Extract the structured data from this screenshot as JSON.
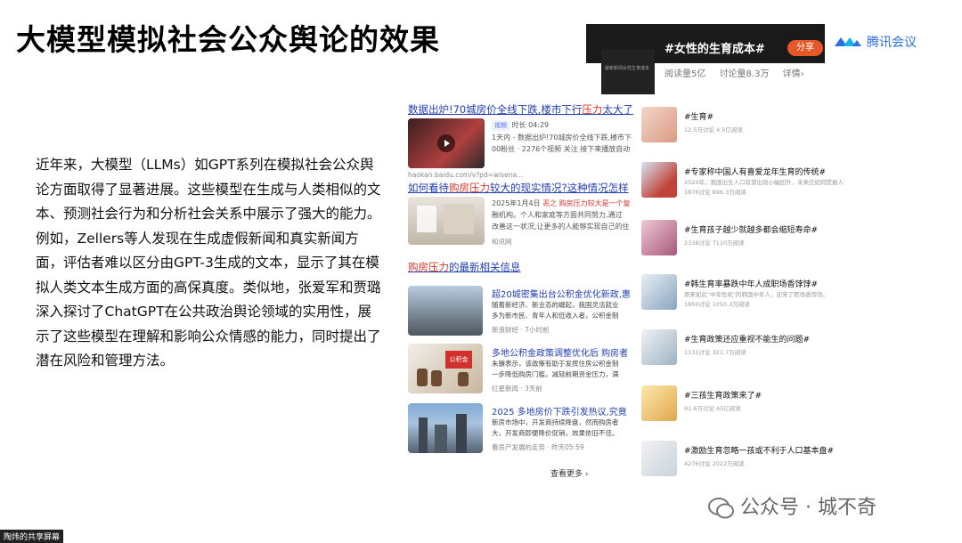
{
  "slide": {
    "title": "大模型模拟社会公众舆论的效果",
    "paragraph": "近年来，大模型（LLMs）如GPT系列在模拟社会公众舆论方面取得了显著进展。这些模型在生成与人类相似的文本、预测社会行为和分析社会关系中展示了强大的能力。例如，Zellers等人发现在生成虚假新闻和真实新闻方面，评估者难以区分由GPT-3生成的文本，显示了其在模拟人类文本生成方面的高保真度。类似地，张爱军和贾璐深入探讨了ChatGPT在公共政治舆论领域的实用性，展示了这些模型在理解和影响公众情感的能力，同时提出了潜在风险和管理方法。"
  },
  "meeting": {
    "topic": "#女性的生育成本#",
    "share_label": "分享",
    "thumb_caption": "最新新闻女性生育成本",
    "stats": {
      "reads": "阅读量5亿",
      "discuss": "讨论量8.3万",
      "detail": "详情›"
    },
    "logo_text": "腾讯会议"
  },
  "results": {
    "r1": {
      "title_a": "数据出炉!70城房价全线下跌,楼市下行",
      "title_red": "压力",
      "title_b": "太大了",
      "tag": "视频",
      "duration": "时长 04:29",
      "snippet_1": "1天内 - 数据出炉!70城房价全线下跌,楼市下",
      "snippet_2": "00粉丝 · 2276个视频 关注 接下来播放自动",
      "source": "haokan.baidu.com/v?pd=wisena..."
    },
    "r2": {
      "title_a": "如何看待",
      "title_red": "购房压力",
      "title_b": "较大的现实情况?这种情况怎样",
      "date": "2025年1月4日",
      "snippet_1": "恶之 购房压力较大是一个复",
      "snippet_2": "融机构。个人和家庭等方面共同努力,通过",
      "snippet_3": "改善这一状况,让更多的人能够实现自己的住",
      "source": "和讯网"
    },
    "news_header_red": "购房压力",
    "news_header_b": "的最新相关信息",
    "news": [
      {
        "title": "超20城密集出台公积金优化新政,惠",
        "body_1": "随着新经济、新业态的崛起，我国灵活就业",
        "body_2": "多为新市民、青年人和低收入者，公积金制",
        "source": "新浪财经 · 7小时前"
      },
      {
        "title": "多地公积金政策调整优化后 购房者",
        "body_1": "朱骥表示，该政策有助于发挥住房公积金制",
        "body_2": "一步降低购房门槛，减轻前期资金压力，满",
        "source": "红星新闻 · 3天前",
        "thumb_label": "公积金"
      },
      {
        "title": "2025 多地房价下跌引发热议,究竟",
        "body_1": "新房市场中，开发商持续降盘，然而购房者",
        "body_2": "大，开发商即便降价促销，效果依旧不佳。",
        "source": "看房产发展的走势 · 昨天05:59"
      }
    ],
    "see_more": "查看更多 ›"
  },
  "topics": [
    {
      "title": "#生育#",
      "desc": "",
      "stats": "12.5万讨论 4.5亿阅读"
    },
    {
      "title": "#专家称中国人有喜爱龙年生育的传统#",
      "desc": "2024年，我国出生人口有望出现小幅回升，未来应如何提振人口发展新常态，建立什么",
      "stats": "1876讨论 896.3万阅读"
    },
    {
      "title": "#生育孩子越少就越多都会缩短寿命#",
      "desc": "",
      "stats": "2338讨论 7110万阅读"
    },
    {
      "title": "#韩生育率暴跌中年人成职场香饽饽#",
      "desc": "原来如此\"中年危机\"的韩国中年人，迎来了职场香饽饽。",
      "stats": "1850讨论 1050.3万阅读"
    },
    {
      "title": "#生育政策还应重视不能生的问题#",
      "desc": "",
      "stats": "1131讨论 321.7万阅读"
    },
    {
      "title": "#三孩生育政策来了#",
      "desc": "",
      "stats": "91.6万讨论 45亿阅读"
    },
    {
      "title": "#激励生育忽略一孩或不利于人口基本盘#",
      "desc": "",
      "stats": "4276讨论 2022万阅读"
    }
  ],
  "watermark": "公众号 · 城不奇",
  "share_screen_label": "陶炜的共享屏幕"
}
